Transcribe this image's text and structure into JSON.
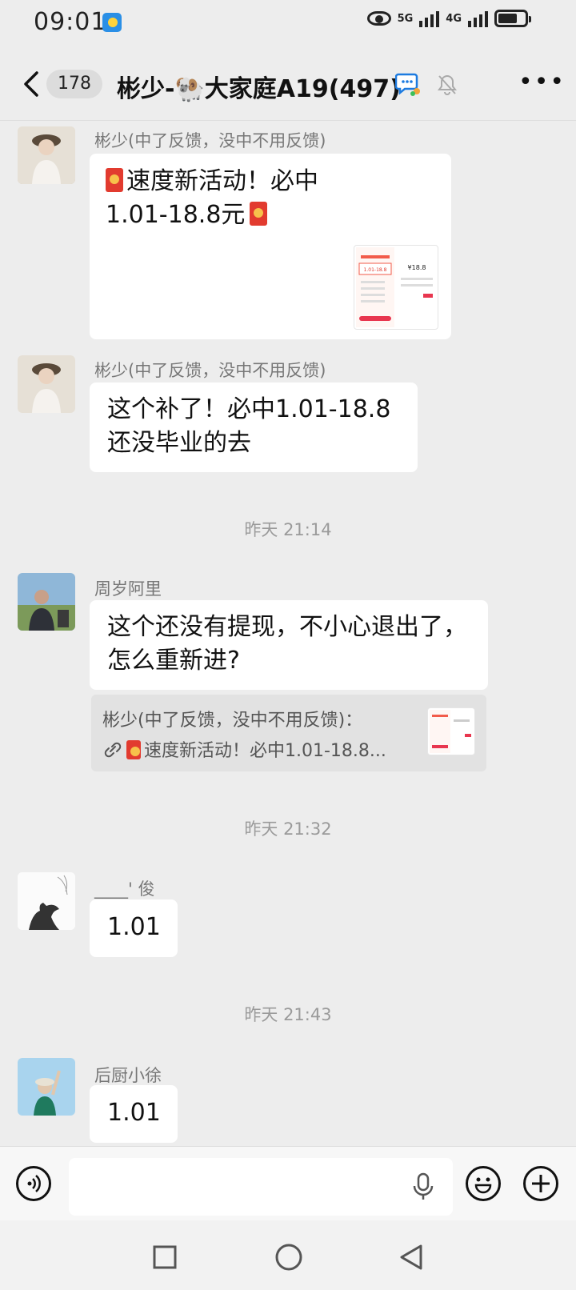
{
  "status_bar": {
    "time": "09:01",
    "net1": "5G",
    "net2": "4G"
  },
  "header": {
    "unread_count": "178",
    "title": "彬少-🐏大家庭A19(497)"
  },
  "messages": [
    {
      "sender": "彬少(中了反馈，没中不用反馈)",
      "type": "link_card",
      "line1": "速度新活动！必中",
      "line2": "1.01-18.8元",
      "thumb_left_text": "1.01-18.8",
      "thumb_right_text": "¥18.8"
    },
    {
      "sender": "彬少(中了反馈，没中不用反馈)",
      "type": "text",
      "line1": "这个补了！必中1.01-18.8",
      "line2": "还没毕业的去"
    },
    {
      "timestamp": "昨天 21:14"
    },
    {
      "sender": "周岁阿里",
      "type": "text",
      "line1": "这个还没有提现，不小心退出了，",
      "line2": "怎么重新进?",
      "quote_sender": "彬少(中了反馈，没中不用反馈)：",
      "quote_text": "速度新活动！必中1.01-18.8..."
    },
    {
      "timestamp": "昨天 21:32"
    },
    {
      "sender": "____' 俊",
      "type": "text",
      "line1": "1.01"
    },
    {
      "timestamp": "昨天 21:43"
    },
    {
      "sender": "后厨小徐",
      "type": "text",
      "line1": "1.01"
    }
  ],
  "input_bar": {
    "placeholder": ""
  },
  "colors": {
    "background": "#ededed",
    "bubble": "#ffffff",
    "red_envelope": "#e23b2f"
  }
}
